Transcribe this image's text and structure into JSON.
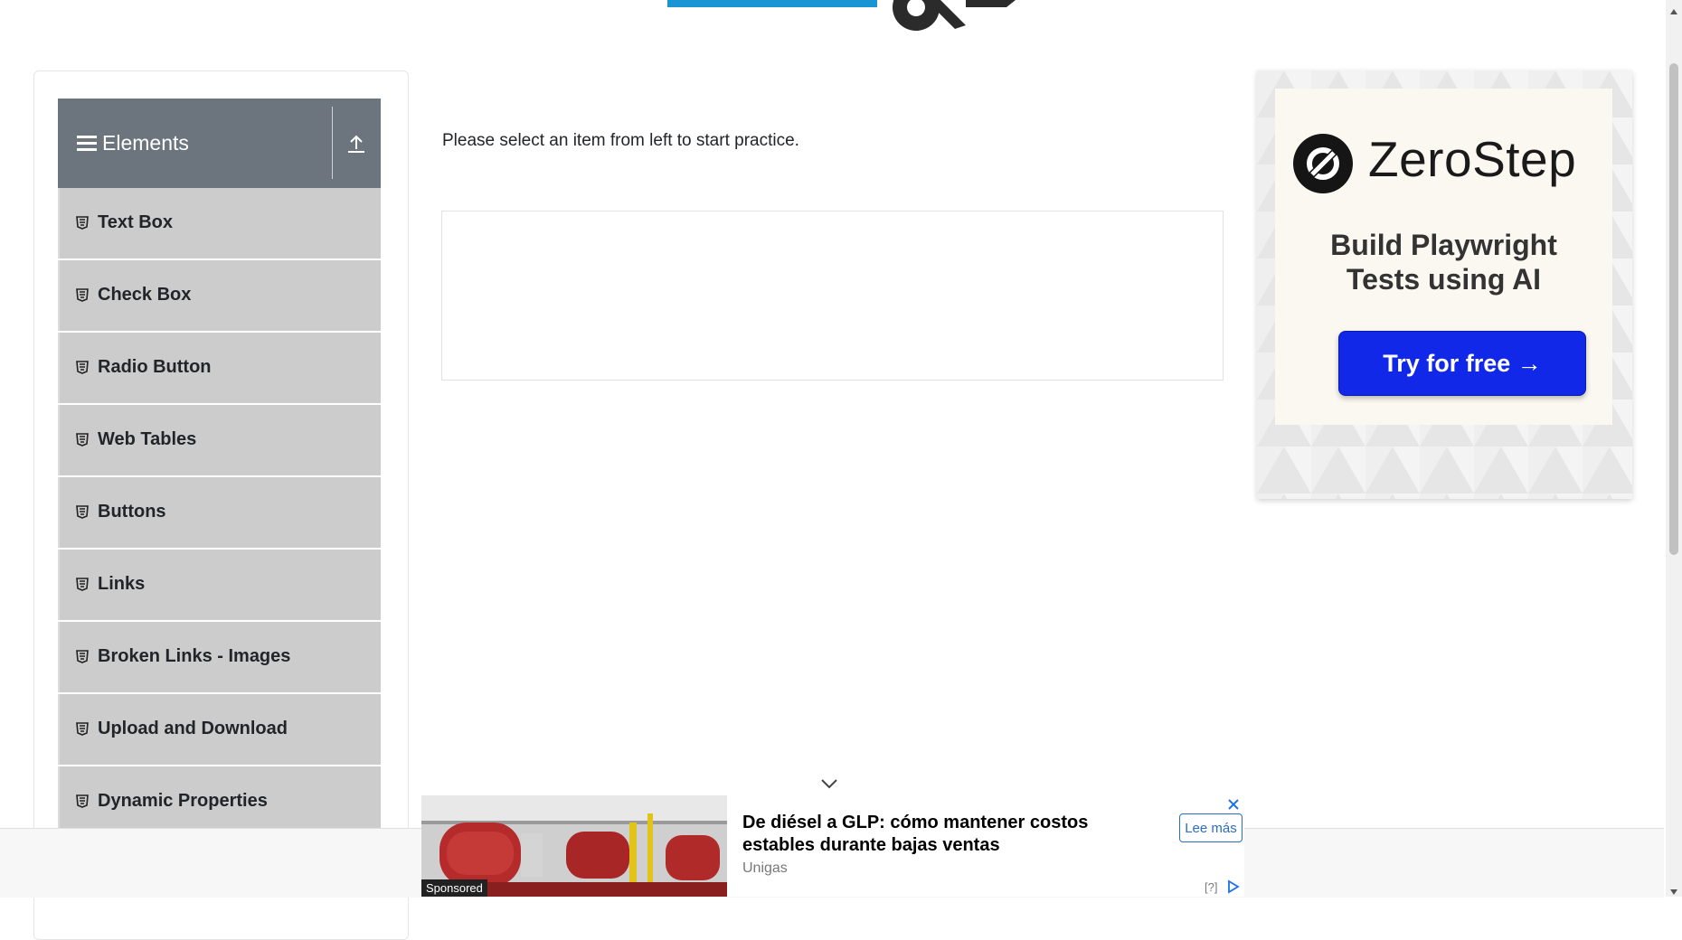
{
  "sidebar": {
    "group_title": "Elements",
    "items": [
      {
        "label": "Text Box"
      },
      {
        "label": "Check Box"
      },
      {
        "label": "Radio Button"
      },
      {
        "label": "Web Tables"
      },
      {
        "label": "Buttons"
      },
      {
        "label": "Links"
      },
      {
        "label": "Broken Links - Images"
      },
      {
        "label": "Upload and Download"
      },
      {
        "label": "Dynamic Properties"
      }
    ]
  },
  "main": {
    "prompt": "Please select an item from left to start practice."
  },
  "ad_right": {
    "brand": "ZeroStep",
    "headline_line1": "Build Playwright",
    "headline_line2": "Tests using AI",
    "cta": "Try for free →",
    "accent": "#1128e8"
  },
  "ad_bottom": {
    "sponsored": "Sponsored",
    "headline": "De diésel a GLP: cómo mantener costos estables durante bajas ventas",
    "advertiser": "Unigas",
    "cta": "Lee más",
    "info": "[?]"
  },
  "colors": {
    "sidebar_header": "#6c757d",
    "menu_item": "#cccccc",
    "logo_blue": "#1a94d3"
  }
}
